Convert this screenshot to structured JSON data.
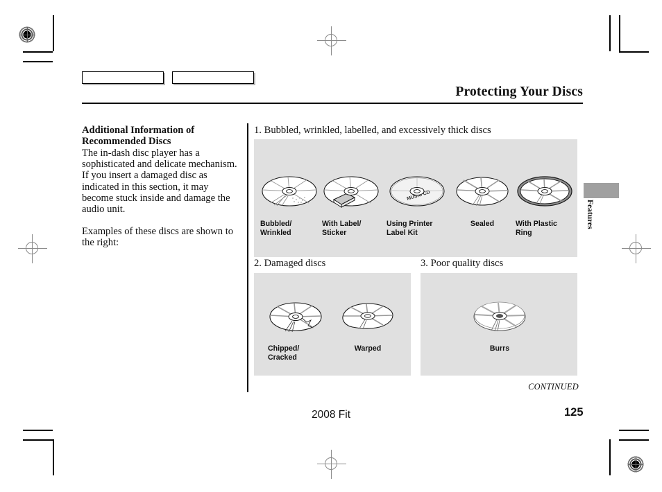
{
  "document": {
    "title": "Protecting Your Discs",
    "footer_model": "2008  Fit",
    "page_number": "125",
    "continued_label": "CONTINUED",
    "side_tab_label": "Features"
  },
  "left_column": {
    "heading_line1": "Additional Information of",
    "heading_line2": "Recommended Discs",
    "body": "The in-dash disc player has a sophisticated and delicate mechanism. If you insert a damaged disc as indicated in this section, it may become stuck inside and damage the audio unit.",
    "body2": "Examples of these discs are shown to the right:"
  },
  "sections": [
    {
      "heading": "1. Bubbled, wrinkled, labelled, and excessively thick discs",
      "figures": [
        {
          "label_line1": "Bubbled/",
          "label_line2": "Wrinkled",
          "disc_text": ""
        },
        {
          "label_line1": "With Label/",
          "label_line2": "Sticker",
          "disc_text": ""
        },
        {
          "label_line1": "Using Printer",
          "label_line2": "Label Kit",
          "disc_text": "MUSIC CD"
        },
        {
          "label_line1": "Sealed",
          "label_line2": "",
          "disc_text": ""
        },
        {
          "label_line1": "With Plastic",
          "label_line2": "Ring",
          "disc_text": ""
        }
      ]
    },
    {
      "heading": "2. Damaged discs",
      "figures": [
        {
          "label_line1": "Chipped/",
          "label_line2": "Cracked",
          "disc_text": ""
        },
        {
          "label_line1": "Warped",
          "label_line2": "",
          "disc_text": ""
        }
      ]
    },
    {
      "heading": "3. Poor quality discs",
      "figures": [
        {
          "label_line1": "Burrs",
          "label_line2": "",
          "disc_text": ""
        }
      ]
    }
  ],
  "top_boxes": [
    {
      "label": ""
    },
    {
      "label": ""
    }
  ],
  "colors": {
    "panel_gray": "#e0e0e0",
    "tab_gray": "#a0a0a0",
    "rule_black": "#000000",
    "text": "#111111"
  }
}
